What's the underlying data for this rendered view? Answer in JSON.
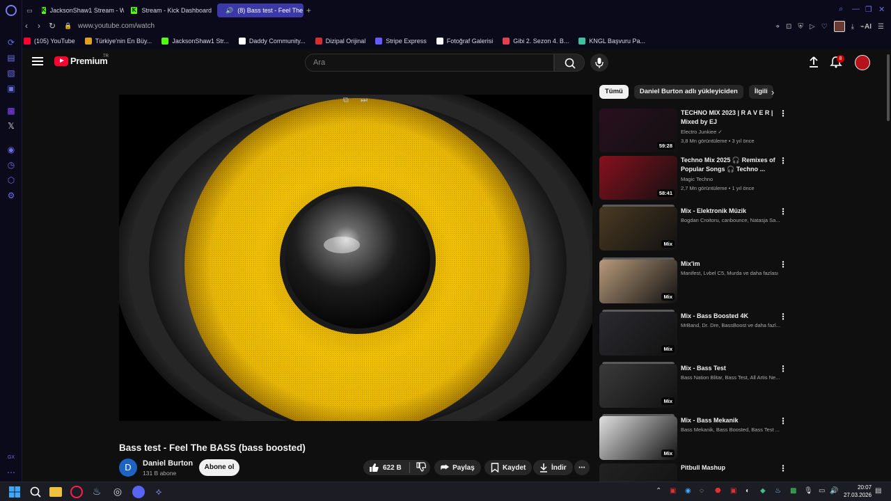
{
  "browser": {
    "tabs": [
      {
        "label": "JacksonShaw1 Stream - W",
        "icon": "kick-icon"
      },
      {
        "label": "Stream - Kick Dashboard",
        "icon": "kick-icon"
      },
      {
        "label": "(8) Bass test - Feel The",
        "icon": "youtube-icon",
        "active": true
      }
    ],
    "url": "www.youtube.com/watch",
    "ai_label": "AI",
    "bookmarks": [
      {
        "label": "(105) YouTube",
        "color": "#ff0033"
      },
      {
        "label": "Türkiye'nin En Büy...",
        "color": "#e0a020"
      },
      {
        "label": "JacksonShaw1 Str...",
        "color": "#53fc18"
      },
      {
        "label": "Daddy Community...",
        "color": "#ffffff"
      },
      {
        "label": "Dizipal Orijinal",
        "color": "#d03030"
      },
      {
        "label": "Stripe Express",
        "color": "#635bff"
      },
      {
        "label": "Fotoğraf Galerisi",
        "color": "#ffffff"
      },
      {
        "label": "Gibi 2. Sezon 4. B...",
        "color": "#e04050"
      },
      {
        "label": "KNGL Başvuru Pa...",
        "color": "#40c0a0"
      }
    ],
    "sidebar_gx_label": "GX"
  },
  "youtube": {
    "logo_text": "Premium",
    "logo_region": "TR",
    "search_placeholder": "Ara",
    "notification_count": "8",
    "video": {
      "title": "Bass test - Feel The BASS (bass boosted)",
      "channel": "Daniel Burton",
      "channel_initial": "D",
      "subscribers": "131 B abone",
      "subscribe_label": "Abone ol",
      "likes": "622 B",
      "share_label": "Paylaş",
      "save_label": "Kaydet",
      "download_label": "İndir"
    },
    "chips": [
      "Tümü",
      "Daniel Burton adlı yükleyiciden",
      "İlgili"
    ],
    "recommendations": [
      {
        "title": "TECHNO MIX 2023 | R A V E R | Mixed by EJ",
        "sub1": "Electro Junkiee ✓",
        "sub2": "3,8 Mn görüntüleme • 3 yıl önce",
        "duration": "59:28",
        "thumb": "#2a0f1e"
      },
      {
        "title": "Techno Mix 2025 🎧 Remixes of Popular Songs 🎧 Techno ...",
        "sub1": "Magic Techno",
        "sub2": "2,7 Mn görüntüleme • 1 yıl önce",
        "duration": "58:41",
        "thumb": "#8a0f1e"
      },
      {
        "title": "Mix - Elektronik Müzik",
        "sub1": "Bogdan Croitoru, canbounce, Natasja Sa...",
        "sub2": "",
        "duration": "Mix",
        "thumb": "#4a3a22"
      },
      {
        "title": "Mix'im",
        "sub1": "Manifest, Lvbel C5, Murda ve daha fazlası",
        "sub2": "",
        "duration": "Mix",
        "thumb": "#b89a7a"
      },
      {
        "title": "Mix - Bass Boosted 4K",
        "sub1": "MrBand, Dr. Dre, BassBoost ve daha fazl...",
        "sub2": "",
        "duration": "Mix",
        "thumb": "#2b2b30"
      },
      {
        "title": "Mix - Bass Test",
        "sub1": "Bass Nation Blitar, Bass Test, All Artis Ne...",
        "sub2": "",
        "duration": "Mix",
        "thumb": "#3a3a3a"
      },
      {
        "title": "Mix - Bass Mekanik",
        "sub1": "Bass Mekanik, Bass Boosted, Bass Test ...",
        "sub2": "",
        "duration": "Mix",
        "thumb": "#e0e0e0"
      },
      {
        "title": "Pitbull Mashup",
        "sub1": "",
        "sub2": "",
        "duration": "",
        "thumb": "#222"
      }
    ]
  },
  "taskbar": {
    "time": "20:07",
    "date": "27.03.2026"
  }
}
